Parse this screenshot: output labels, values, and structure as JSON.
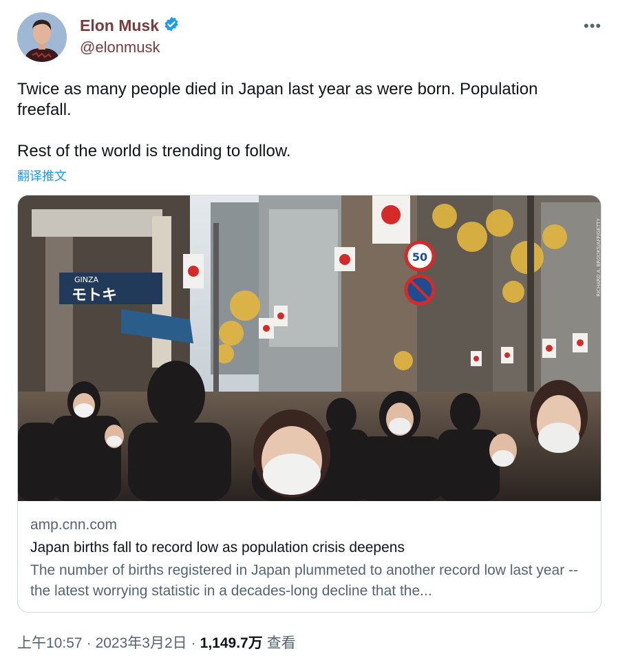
{
  "author": {
    "name": "Elon Musk",
    "handle": "@elonmusk"
  },
  "tweet": {
    "text": "Twice as many people died in Japan last year as were born. Population freefall.\n\nRest of the world is trending to follow.",
    "translate_label": "翻译推文"
  },
  "card": {
    "domain": "amp.cnn.com",
    "title": "Japan births fall to record low as population crisis deepens",
    "description": "The number of births registered in Japan plummeted to another record low last year -- the latest worrying statistic in a decades-long decline that the...",
    "photo": {
      "store_sign_top": "GINZA",
      "store_sign_main": "モトキ",
      "speed_limit_sign": "50",
      "credit": "RICHARD A. BROOKS/AFP/GETTY"
    }
  },
  "meta": {
    "time": "上午10:57",
    "date": "2023年3月2日",
    "sep": "·",
    "views": "1,149.7万",
    "views_label": "查看"
  },
  "icons": {
    "verified": "verified-badge-icon",
    "more": "more-options-icon"
  },
  "colors": {
    "accent": "#1d9bf0",
    "name": "#7a3b3b",
    "muted": "#536471"
  }
}
